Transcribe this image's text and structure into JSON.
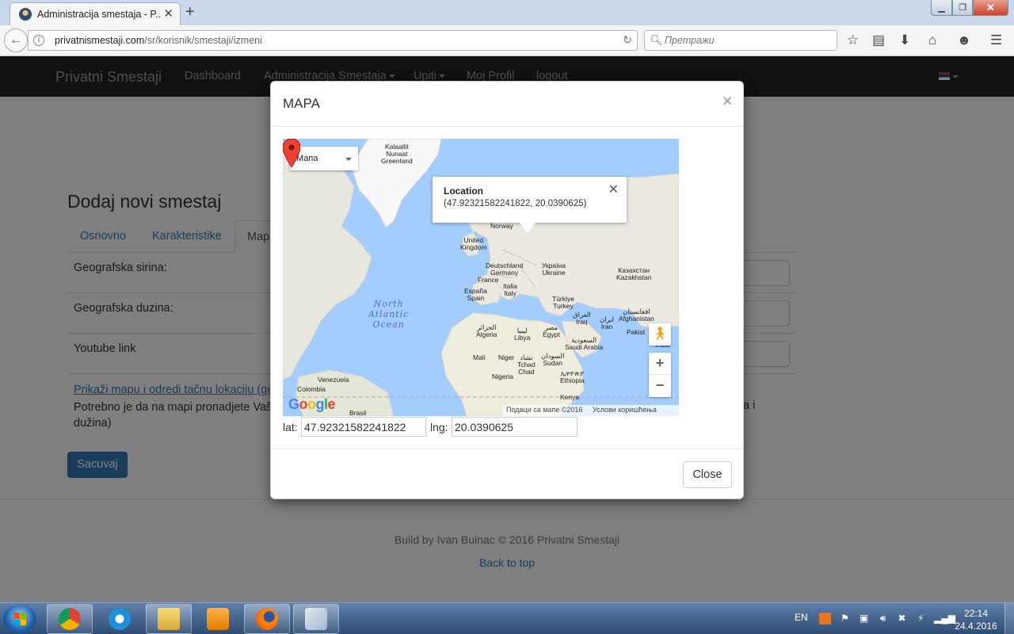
{
  "browser": {
    "tab_title": "Administracija smestaja - P...",
    "url_host": "privatnismestaji.com",
    "url_path": "/sr/korisnik/smestaji/izmeni",
    "search_placeholder": "Претражи"
  },
  "site": {
    "brand": "Privatni Smestaji",
    "nav": [
      "Dashboard",
      "Administracija Smestaja",
      "Upiti",
      "Moj Profil",
      "logout"
    ]
  },
  "page": {
    "title": "Dodaj novi smestaj",
    "tabs": [
      "Osnovno",
      "Karakteristike",
      "Mapa"
    ],
    "rows": [
      "Geografska sirina:",
      "Geografska duzina:",
      "Youtube link"
    ],
    "map_link": "Prikaži mapu i odredi tačnu lokaciju (ge",
    "help_text": "Potrebno je da na mapi pronadjete Vaš",
    "help_text_tail": "a i",
    "help_text_line2": "dužina)",
    "save_label": "Sacuvaj",
    "footer": "Build by Ivan Buinac © 2016 Privatni Smestaji",
    "back_to_top": "Back to top"
  },
  "modal": {
    "title": "MAPA",
    "close_x": "×",
    "close_label": "Close",
    "map": {
      "type_label": "Мапа",
      "info_title": "Location",
      "info_coords": "(47.92321582241822, 20.0390625)",
      "zoom_in": "+",
      "zoom_out": "−",
      "attribution": "Подаци са мапе ©2016",
      "terms": "Услови коришћења",
      "google": [
        "G",
        "o",
        "o",
        "g",
        "l",
        "e"
      ],
      "labels": {
        "greenland": "Kalaallit\nNunaat\nGreenland",
        "norway": "Norway",
        "uk": "United\nKingdom",
        "germany": "Deutschland\nGermany",
        "ukraine": "Україна\nUkraine",
        "kazakhstan": "Казахстан\nKazakhstan",
        "france": "France",
        "italy": "Italia\nItaly",
        "spain": "España\nSpain",
        "turkey": "Türkiye\nTurkey",
        "ocean": "North\nAtlantic\nOcean",
        "iraq": "العراق\nIraq",
        "iran": "ایران\nIran",
        "afghanistan": "افغانستان\nAfghanistan",
        "pakistan": "Pakist",
        "india": "India",
        "algeria": "الجزائر\nAlgeria",
        "libya": "ليبيا\nLibya",
        "egypt": "مصر\nEgypt",
        "saudi": "السعودية\nSaudi Arabia",
        "mali": "Mali",
        "niger": "Niger",
        "chad": "تشاد\nTchad\nChad",
        "sudan": "السودان\nSudan",
        "nigeria": "Nigeria",
        "ethiopia": "ኢትዮጵያ\nEthiopia",
        "kenya": "Kenya",
        "venezuela": "Venezuela",
        "colombia": "Colombia",
        "brasil": "Brasil"
      }
    },
    "lat_label": "lat:",
    "lat_value": "47.92321582241822",
    "lng_label": "lng:",
    "lng_value": "20.0390625"
  },
  "taskbar": {
    "lang": "EN",
    "time": "22:14",
    "date": "24.4.2016"
  },
  "colors": {
    "primary": "#337ab7",
    "navbar": "#222222",
    "map_water": "#a3ccff",
    "map_land": "#f2efe9",
    "marker": "#ea4335"
  }
}
